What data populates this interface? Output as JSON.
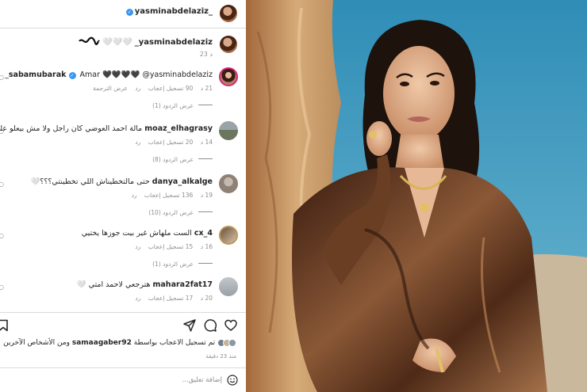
{
  "post": {
    "username": "yasminabdelaziz_",
    "caption_text": "_yasminabdelaziz",
    "caption_hearts": "🤍🤍🤍",
    "time": "23 د"
  },
  "comments": [
    {
      "username": "sabamubarak",
      "text": "Amar 🖤🖤🖤🖤 @yasminabdelaziz_",
      "age": "21 د",
      "likes": "90 تسجيل إعجاب",
      "reply": "رد",
      "translate": "عرض الترجمة",
      "replies": "عرض الردود (1)"
    },
    {
      "username": "moaz_elhagrasy",
      "text": "مالة احمد العوضي كان راجل ولا مش بيعلو عليتكو غير التراب",
      "age": "14 د",
      "likes": "20 تسجيل إعجاب",
      "reply": "رد",
      "translate": "",
      "replies": "عرض الردود (8)"
    },
    {
      "username": "danya_alkalge",
      "text": "حتى مالتخطيناش اللي تخطينتي؟؟؟🤍",
      "age": "19 د",
      "likes": "136 تسجيل إعجاب",
      "reply": "رد",
      "translate": "",
      "replies": "عرض الردود (10)"
    },
    {
      "username": "cx_4",
      "text": "الست ملهاش غير بيت جوزها يختيي",
      "age": "16 د",
      "likes": "15 تسجيل إعجاب",
      "reply": "رد",
      "translate": "",
      "replies": "عرض الردود (1)"
    },
    {
      "username": "mahara2fat17",
      "text": "هترجعي لاحمد امتي 🤍",
      "age": "20 د",
      "likes": "17 تسجيل إعجاب",
      "reply": "رد",
      "translate": "",
      "replies": ""
    }
  ],
  "likes_line": {
    "prefix": "تم تسجيل الاعجاب بواسطة",
    "user": "samaagaber92",
    "suffix": "ومن الأشخاص الآخرين"
  },
  "post_time": "منذ 23 دقيقة",
  "add_comment_placeholder": "إضافة تعليق...",
  "icons": {
    "like": "heart-icon",
    "comment": "comment-icon",
    "share": "send-icon",
    "save": "bookmark-icon",
    "emoji": "emoji-icon"
  },
  "colors": {
    "verified": "#3897f0",
    "sky": "#3f9fc3",
    "dress": "#5a3220"
  }
}
